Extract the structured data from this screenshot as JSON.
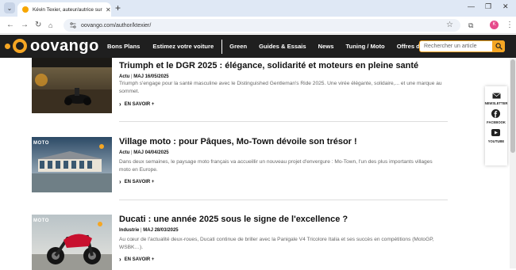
{
  "browser": {
    "tab_title": "Kévin Texier, auteur/autrice sur",
    "url": "oovango.com/author/ktexier/"
  },
  "profile": {
    "initial": "K"
  },
  "site": {
    "logo_text": "oovango",
    "menu": [
      "Bons Plans",
      "Estimez votre voiture",
      "Green",
      "Guides & Essais",
      "News",
      "Tuning / Moto",
      "Offres d'emploi"
    ],
    "search_placeholder": "Rechercher un article"
  },
  "articles": [
    {
      "title": "Triumph et le DGR 2025 : élégance, solidarité et moteurs en pleine santé",
      "category": "Actu",
      "date": "MAJ 16/05/2025",
      "excerpt": "Triumph s'engage pour la santé masculine avec le Distinguished Gentleman's Ride 2025. Une virée élégante, solidaire,... et une marque au sommet.",
      "more": "EN SAVOIR +",
      "badge": ""
    },
    {
      "title": "Village moto : pour Pâques, Mo-Town dévoile son trésor !",
      "category": "Actu",
      "date": "MAJ 04/04/2025",
      "excerpt": "Dans deux semaines, le paysage moto français va accueillir un nouveau projet d'envergure : Mo-Town, l'un des plus importants villages moto en Europe.",
      "more": "EN SAVOIR +",
      "badge": "MOTO"
    },
    {
      "title": "Ducati : une année 2025 sous le signe de l'excellence ?",
      "category": "Industrie",
      "date": "MAJ 28/03/2025",
      "excerpt": "Au cœur de l'actualité deux-roues, Ducati continue de briller avec la Panigale V4 Tricolore Italia et ses succès en compétitions (MotoGP, WSBK…).",
      "more": "EN SAVOIR +",
      "badge": "MOTO"
    }
  ],
  "share": [
    "NEWSLETTER",
    "FACEBOOK",
    "YOUTUBE"
  ],
  "colors": {
    "accent": "#f5a623",
    "header_bg": "#1f1f1f"
  }
}
